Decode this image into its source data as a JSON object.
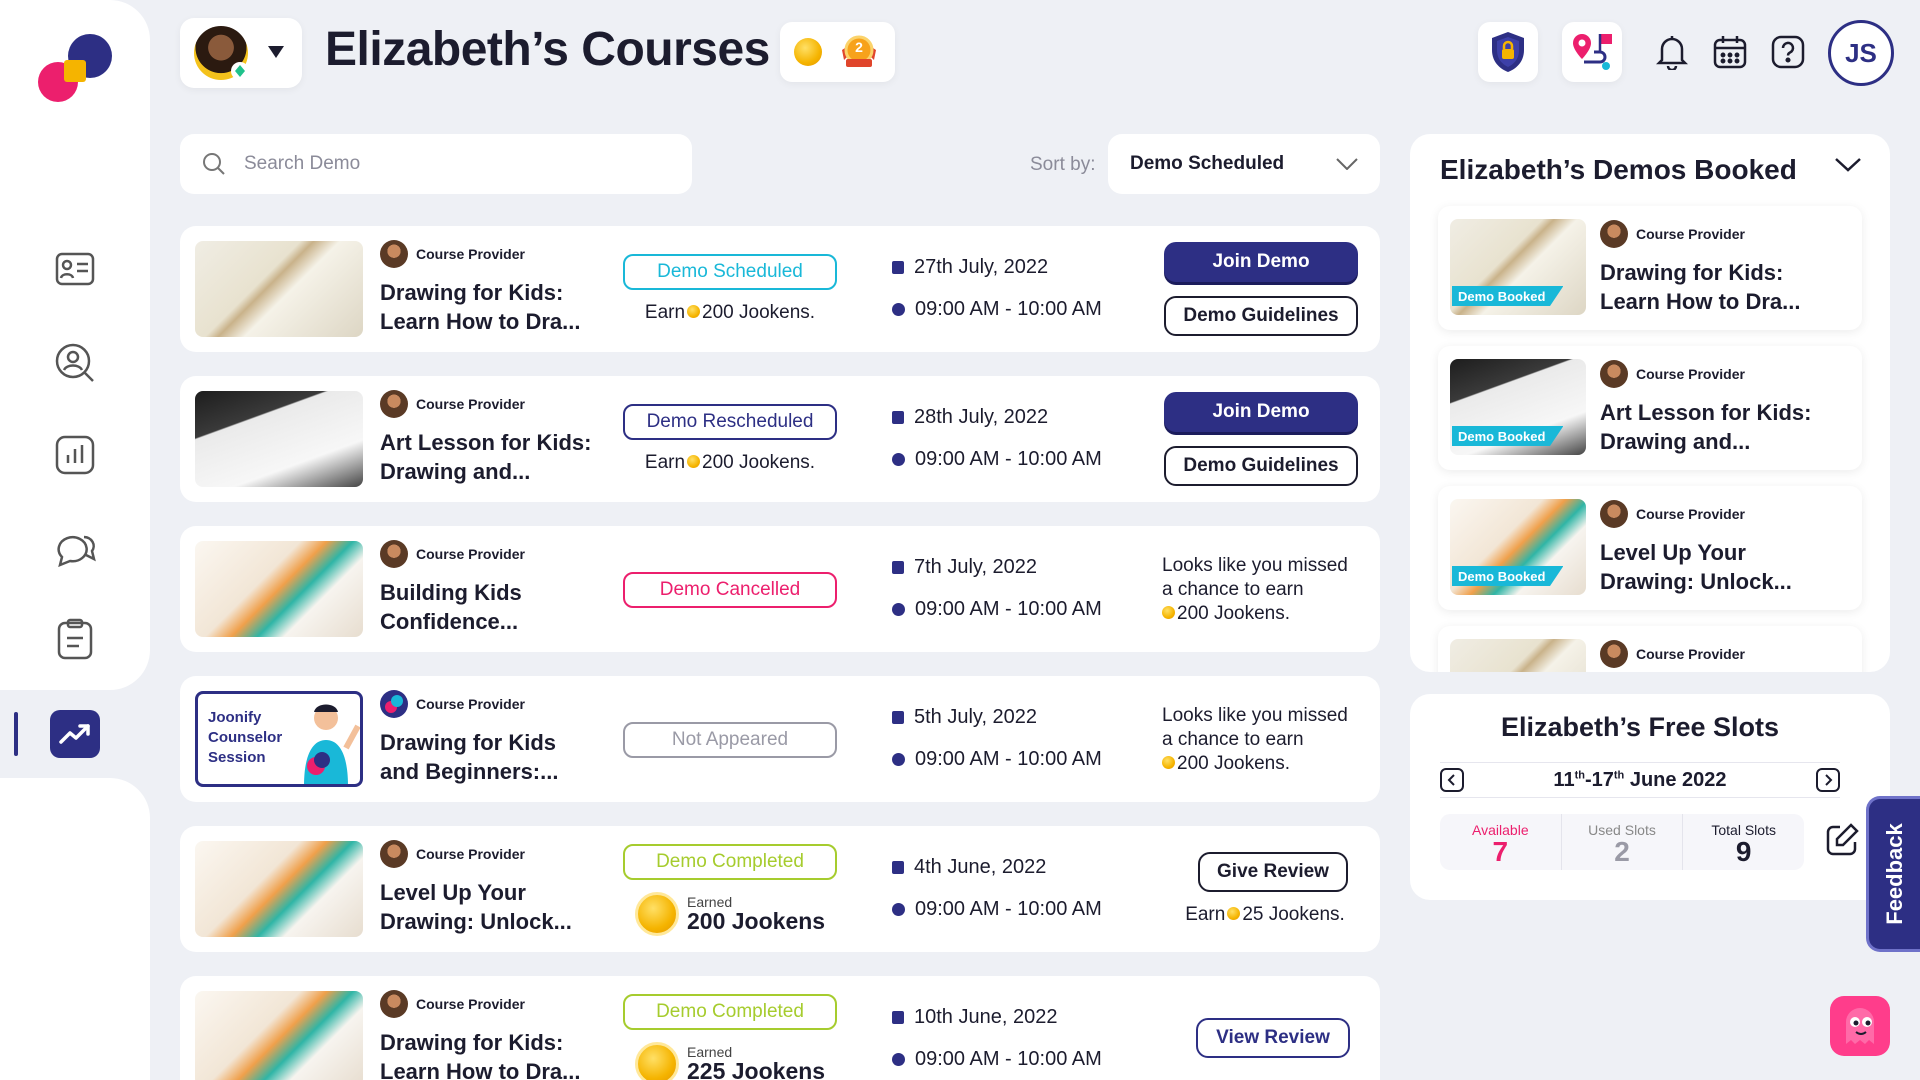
{
  "header": {
    "title": "Elizabeth’s Courses",
    "user_initials": "JS",
    "badge_level": "2"
  },
  "icons": [
    "logo-icon",
    "id-card-icon",
    "user-search-icon",
    "stats-icon",
    "chat-icon",
    "clipboard-icon",
    "trend-icon",
    "shield-lock-icon",
    "map-route-icon",
    "bell-icon",
    "calendar-icon",
    "help-icon"
  ],
  "search": {
    "placeholder": "Search Demo"
  },
  "sort": {
    "label": "Sort by:",
    "value": "Demo Scheduled"
  },
  "demos": [
    {
      "provider": "Course Provider",
      "title_1": "Drawing for Kids:",
      "title_2": "Learn How to Dra...",
      "status": "Demo Scheduled",
      "earn_pre": "Earn",
      "earn_post": "200 Jookens.",
      "date": "27th July, 2022",
      "time": "09:00 AM - 10:00 AM",
      "btn1": "Join Demo",
      "btn2": "Demo Guidelines"
    },
    {
      "provider": "Course Provider",
      "title_1": "Art Lesson for Kids:",
      "title_2": "Drawing and...",
      "status": "Demo Rescheduled",
      "earn_pre": "Earn",
      "earn_post": "200 Jookens.",
      "date": "28th July, 2022",
      "time": "09:00 AM - 10:00 AM",
      "btn1": "Join Demo",
      "btn2": "Demo Guidelines"
    },
    {
      "provider": "Course Provider",
      "title_1": "Building Kids",
      "title_2": "Confidence...",
      "status": "Demo Cancelled",
      "date": "7th July, 2022",
      "time": "09:00 AM - 10:00 AM",
      "missed_1": "Looks like you missed",
      "missed_2": "a chance to earn",
      "missed_3": "200 Jookens."
    },
    {
      "provider": "Course Provider",
      "title_1": "Drawing for Kids",
      "title_2": "and Beginners:...",
      "status": "Not Appeared",
      "thumb_1": "Joonify",
      "thumb_2": "Counselor",
      "thumb_3": "Session",
      "date": "5th July, 2022",
      "time": "09:00 AM - 10:00 AM",
      "missed_1": "Looks like you missed",
      "missed_2": "a chance to earn",
      "missed_3": "200 Jookens."
    },
    {
      "provider": "Course Provider",
      "title_1": "Level Up Your",
      "title_2": "Drawing: Unlock...",
      "status": "Demo Completed",
      "earned_label": "Earned",
      "earned_value": "200 Jookens",
      "date": "4th June, 2022",
      "time": "09:00 AM - 10:00 AM",
      "btn1": "Give Review",
      "earn_pre": "Earn",
      "earn_post": "25 Jookens."
    },
    {
      "provider": "Course Provider",
      "title_1": "Drawing for Kids:",
      "title_2": "Learn How to Dra...",
      "status": "Demo Completed",
      "earned_label": "Earned",
      "earned_value": "225 Jookens",
      "date": "10th June, 2022",
      "time": "09:00 AM - 10:00 AM",
      "btn1": "View Review"
    }
  ],
  "booked": {
    "title": "Elizabeth’s Demos Booked",
    "items": [
      {
        "badge": "Demo Booked",
        "provider": "Course Provider",
        "title_1": "Drawing for Kids:",
        "title_2": "Learn How to Dra..."
      },
      {
        "badge": "Demo Booked",
        "provider": "Course Provider",
        "title_1": "Art Lesson for Kids:",
        "title_2": "Drawing and..."
      },
      {
        "badge": "Demo Booked",
        "provider": "Course Provider",
        "title_1": "Level Up Your",
        "title_2": "Drawing: Unlock..."
      },
      {
        "provider": "Course Provider"
      }
    ]
  },
  "slots": {
    "title": "Elizabeth’s Free Slots",
    "week_a": "11",
    "week_a_sup": "th",
    "week_sep": "-17",
    "week_b_sup": "th",
    "week_rest": " June 2022",
    "available_label": "Available",
    "available": "7",
    "used_label": "Used Slots",
    "used": "2",
    "total_label": "Total Slots",
    "total": "9"
  },
  "feedback": "Feedback",
  "colors": {
    "primary": "#2d2f84",
    "scheduled": "#19b8d8",
    "rescheduled": "#2d2f84",
    "cancelled": "#ec1f6d",
    "not_appeared": "#9a9aa6",
    "completed": "#a6cc2e",
    "accent_pink": "#ec1f6d"
  }
}
